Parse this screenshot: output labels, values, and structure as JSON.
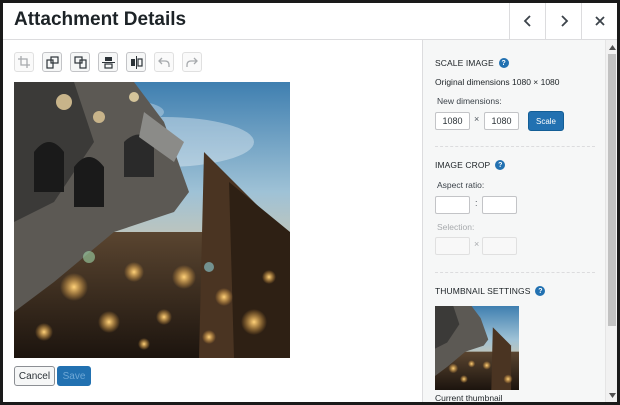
{
  "header": {
    "title": "Attachment Details"
  },
  "header_buttons": [
    {
      "icon": "chevron-left-icon"
    },
    {
      "icon": "chevron-right-icon"
    },
    {
      "icon": "close-icon"
    }
  ],
  "toolbar": {
    "tools": [
      {
        "icon": "crop-icon",
        "enabled": false
      },
      {
        "icon": "rotate-left-icon",
        "enabled": true
      },
      {
        "icon": "rotate-right-icon",
        "enabled": true
      },
      {
        "icon": "flip-vertical-icon",
        "enabled": true
      },
      {
        "icon": "flip-horizontal-icon",
        "enabled": true
      },
      {
        "icon": "undo-icon",
        "enabled": false
      },
      {
        "icon": "redo-icon",
        "enabled": false
      }
    ]
  },
  "actions": {
    "cancel_label": "Cancel",
    "save_label": "Save"
  },
  "scale": {
    "title": "SCALE IMAGE",
    "original": "Original dimensions 1080 × 1080",
    "new_label": "New dimensions:",
    "width": "1080",
    "height": "1080",
    "times": "×",
    "button": "Scale"
  },
  "crop": {
    "title": "IMAGE CROP",
    "aspect_label": "Aspect ratio:",
    "colon": ":",
    "selection_label": "Selection:",
    "times": "×"
  },
  "thumbnail": {
    "title": "THUMBNAIL SETTINGS",
    "caption": "Current thumbnail"
  },
  "colors": {
    "accent": "#2271b1",
    "panel": "#f6f7f7",
    "border": "#dcdcde"
  }
}
